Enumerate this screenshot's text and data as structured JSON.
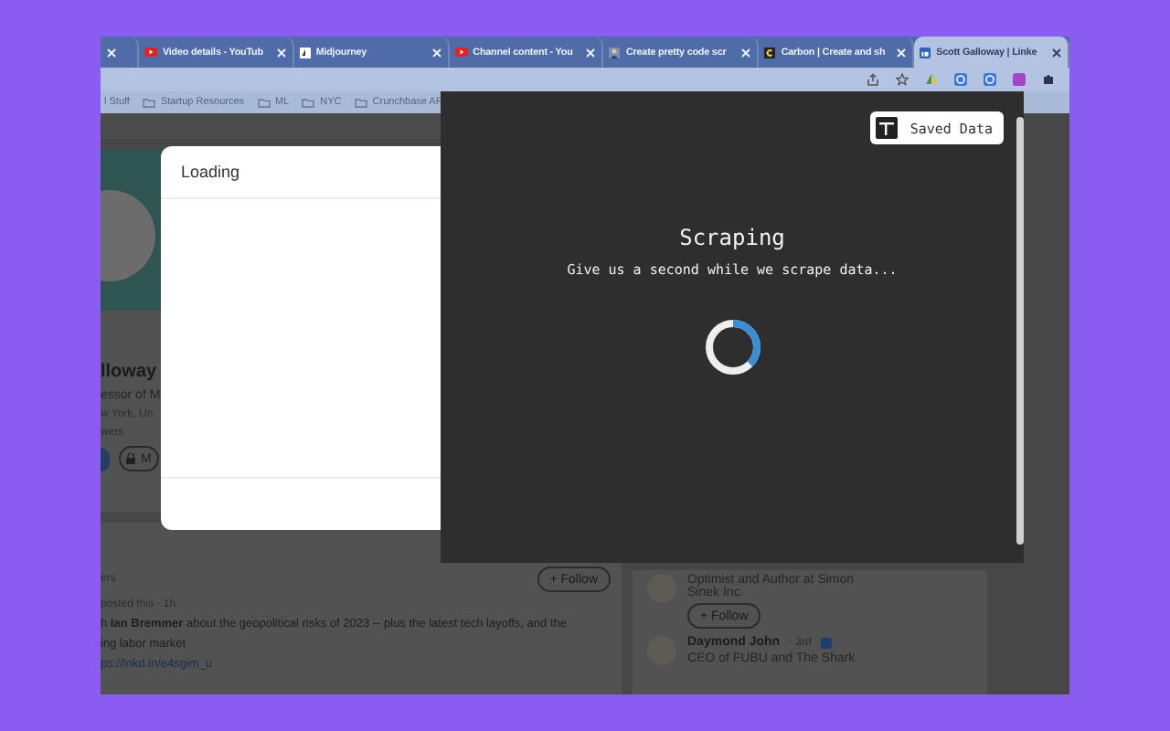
{
  "browser": {
    "tabs": [
      {
        "kind": "blank",
        "selected": false
      },
      {
        "kind": "video",
        "title": "Video details - YouTub",
        "selected": false
      },
      {
        "kind": "sail",
        "title": "Midjourney",
        "selected": false
      },
      {
        "kind": "video",
        "title": "Channel content - You",
        "selected": false
      },
      {
        "kind": "photo",
        "title": "Create pretty code scr",
        "selected": false
      },
      {
        "kind": "carbon",
        "title": "Carbon | Create and sh",
        "selected": false
      },
      {
        "kind": "profile",
        "title": "Scott Galloway | Linke",
        "selected": true
      }
    ],
    "bookmarks": [
      "l Stuff",
      "Startup Resources",
      "ML",
      "NYC",
      "Crunchbase AF"
    ]
  },
  "background_page": {
    "profile": {
      "name": "lloway",
      "headline": "essor of M",
      "location": "w York, Un",
      "followers": "wers",
      "message_button": "M"
    },
    "activity": {
      "heading": "ers",
      "meta": "posted this · 1h",
      "follow_button": "+ Follow",
      "lines": [
        "h **Ian Bremmer** about the geopolitical risks of 2023 -- plus the latest tech layoffs, and the",
        "ing labor market"
      ],
      "link": "ps://lnkd.in/e4sgim_u"
    },
    "people": [
      {
        "headline": "Optimist and Author at Simon Sinek Inc.",
        "follow_button": "+ Follow"
      },
      {
        "name": "Daymond John",
        "degree": "· 3rd",
        "headline": "CEO of FUBU and The Shark"
      }
    ]
  },
  "loading_dialog": {
    "title": "Loading"
  },
  "scraper_panel": {
    "saved_data_button": "Saved Data",
    "title": "Scraping",
    "subtitle": "Give us a second while we scrape data..."
  }
}
